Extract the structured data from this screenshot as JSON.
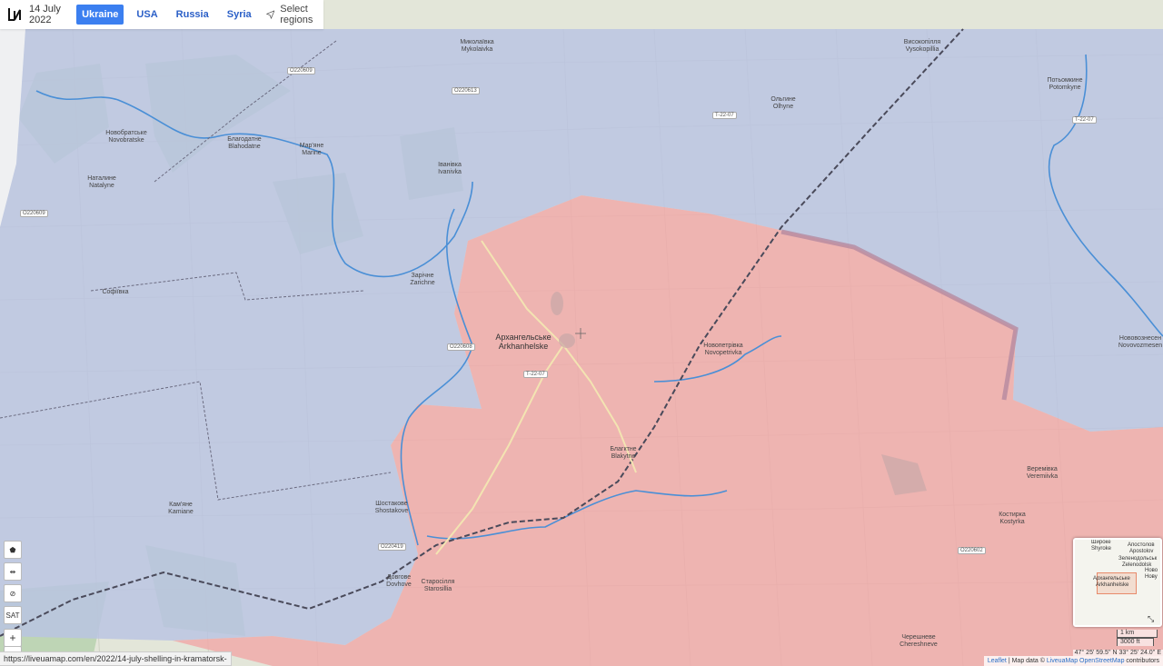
{
  "header": {
    "date": "14 July 2022",
    "tabs": [
      {
        "label": "Ukraine",
        "active": true
      },
      {
        "label": "USA",
        "active": false
      },
      {
        "label": "Russia",
        "active": false
      },
      {
        "label": "Syria",
        "active": false
      }
    ],
    "select_regions": "Select regions"
  },
  "map": {
    "places": [
      {
        "ua": "Миколаївка",
        "en": "Mykolaivka"
      },
      {
        "ua": "Високопілля",
        "en": "Vysokopillia"
      },
      {
        "ua": "Ольгине",
        "en": "Olhyne"
      },
      {
        "ua": "Потьомкине",
        "en": "Potomkyne"
      },
      {
        "ua": "Новобратське",
        "en": "Novobratske"
      },
      {
        "ua": "Благодатне",
        "en": "Blahodatne"
      },
      {
        "ua": "Мар'яне",
        "en": "Marine"
      },
      {
        "ua": "Іванівка",
        "en": "Ivanivka"
      },
      {
        "ua": "Наталине",
        "en": "Natalyne"
      },
      {
        "ua": "Зарічне",
        "en": "Zarichne"
      },
      {
        "ua": "Софіївка",
        "en": ""
      },
      {
        "ua": "Архангельське",
        "en": "Arkhanhelske"
      },
      {
        "ua": "Новопетрівка",
        "en": "Novopetrivka"
      },
      {
        "ua": "Благктне",
        "en": "Blakytne"
      },
      {
        "ua": "Веремівка",
        "en": "Veremiivka"
      },
      {
        "ua": "Кам'яне",
        "en": "Kamiane"
      },
      {
        "ua": "Шостакове",
        "en": "Shostakove"
      },
      {
        "ua": "Костирка",
        "en": "Kostyrka"
      },
      {
        "ua": "Довгове",
        "en": "Dovhove"
      },
      {
        "ua": "Старосілля",
        "en": "Starosillia"
      },
      {
        "ua": "Черешневе",
        "en": "Chereshneve"
      },
      {
        "ua": "Нововознесен",
        "en": "Novovozmesen"
      }
    ],
    "roads": [
      "O220609",
      "O220613",
      "T-22-07",
      "T-22-07",
      "O220609",
      "O220608",
      "T-22-07",
      "O220419",
      "O220602"
    ],
    "colors": {
      "occupied": "#f0a8a8",
      "controlled": "#b9c3e3",
      "river": "#4a8fd6",
      "rail": "#4a4a5a"
    }
  },
  "controls": {
    "buttons": [
      "⬟",
      "⇹",
      "⊘",
      "SAT",
      "+",
      "−"
    ]
  },
  "status_url": "https://liveuamap.com/en/2022/14-july-shelling-in-kramatorsk-",
  "minimap": {
    "labels": [
      "Широке",
      "Shyroke",
      "Апостолов",
      "Apostolov",
      "Зеленодольськ",
      "Zelenodolsk",
      "Ново",
      "Нову",
      "Архангельське",
      "Arkhanhelske"
    ]
  },
  "scale": {
    "km": "1 km",
    "ft": "3000 ft"
  },
  "coords": "47° 25' 59.5'' N 33° 25' 24.0'' E",
  "attribution": {
    "leaflet": "Leaflet",
    "sep": " | Map data © ",
    "lum": "LiveuaMap",
    "osm": "OpenStreetMap",
    "rest": " contributors"
  }
}
